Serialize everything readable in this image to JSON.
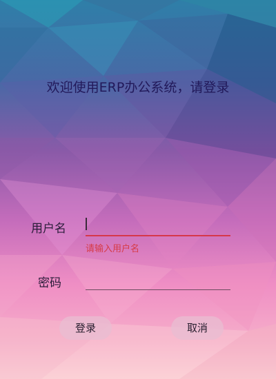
{
  "header": {
    "title": "欢迎使用ERP办公系统，请登录"
  },
  "form": {
    "username": {
      "label": "用户名",
      "value": "",
      "error": "请输入用户名"
    },
    "password": {
      "label": "密码",
      "value": ""
    }
  },
  "actions": {
    "login_label": "登录",
    "cancel_label": "取消"
  },
  "colors": {
    "error": "#d63a46",
    "title": "#22195a",
    "button_bg": "#e8bed2"
  }
}
